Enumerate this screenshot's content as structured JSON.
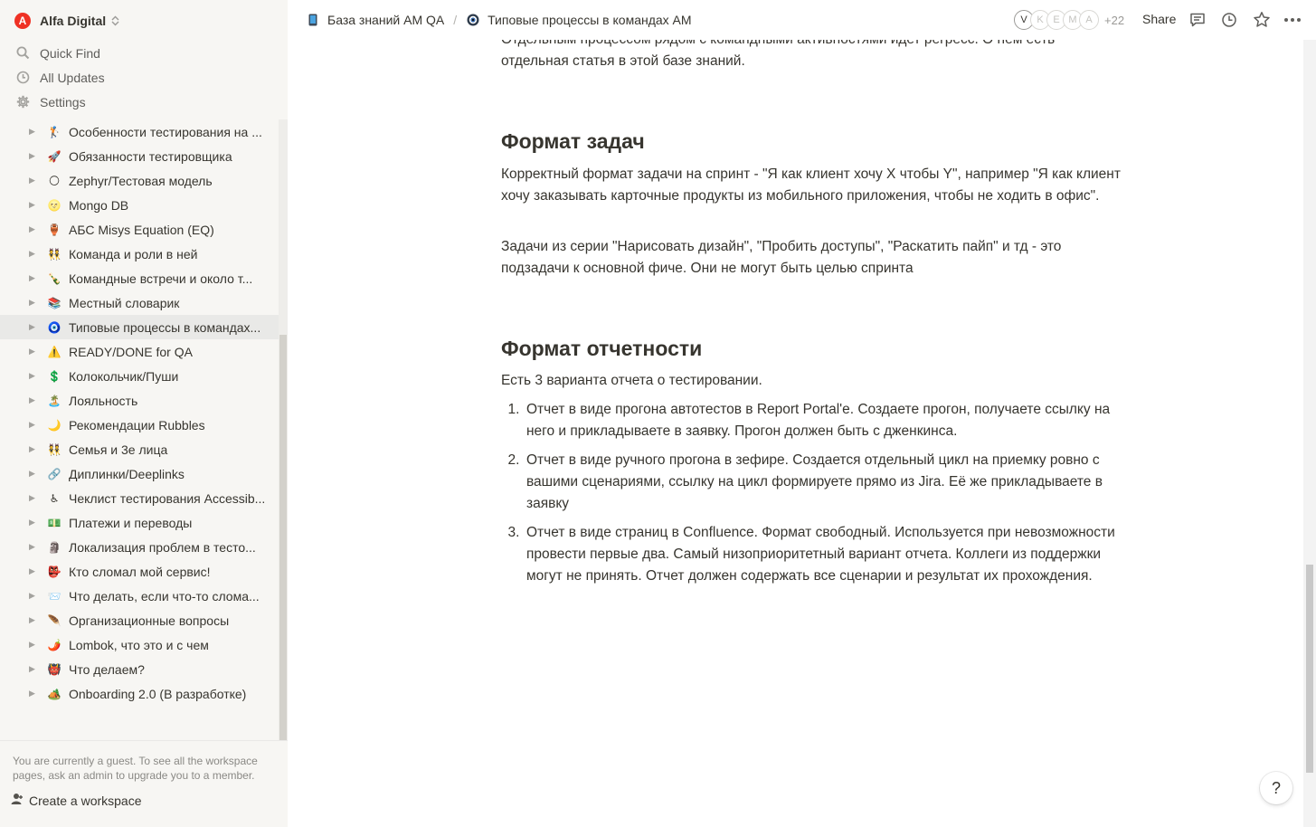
{
  "workspace": {
    "logo_letter": "A",
    "name": "Alfa Digital"
  },
  "nav": [
    {
      "label": "Quick Find",
      "icon": "search-icon"
    },
    {
      "label": "All Updates",
      "icon": "clock-icon"
    },
    {
      "label": "Settings",
      "icon": "gear-icon"
    }
  ],
  "tree": [
    {
      "emoji": "🏌️",
      "label": "Особенности тестирования на ...",
      "active": false
    },
    {
      "emoji": "🚀",
      "label": "Обязанности тестировщика",
      "active": false
    },
    {
      "emoji": "🌕",
      "label": "Zephyr/Тестовая модель",
      "active": false
    },
    {
      "emoji": "🌝",
      "label": "Mongo DB",
      "active": false
    },
    {
      "emoji": "🏺",
      "label": "АБС Misys Equation (EQ)",
      "active": false
    },
    {
      "emoji": "👯",
      "label": "Команда и роли в ней",
      "active": false
    },
    {
      "emoji": "🍾",
      "label": "Командные встречи и около т...",
      "active": false
    },
    {
      "emoji": "📚",
      "label": "Местный словарик",
      "active": false
    },
    {
      "emoji": "🧿",
      "label": "Типовые процессы в командах...",
      "active": true
    },
    {
      "emoji": "⚠️",
      "label": "READY/DONE for QA",
      "active": false
    },
    {
      "emoji": "💲",
      "label": "Колокольчик/Пуши",
      "active": false
    },
    {
      "emoji": "🏝️",
      "label": "Лояльность",
      "active": false
    },
    {
      "emoji": "🌙",
      "label": "Рекомендации Rubbles",
      "active": false
    },
    {
      "emoji": "👯",
      "label": "Семья и 3е лица",
      "active": false
    },
    {
      "emoji": "🔗",
      "label": "Диплинки/Deeplinks",
      "active": false
    },
    {
      "emoji": "♿",
      "label": "Чеклист тестирования Accessib...",
      "active": false
    },
    {
      "emoji": "💵",
      "label": "Платежи и переводы",
      "active": false
    },
    {
      "emoji": "🗿",
      "label": "Локализация проблем в тесто...",
      "active": false
    },
    {
      "emoji": "👺",
      "label": "Кто сломал мой сервис!",
      "active": false
    },
    {
      "emoji": "📨",
      "label": "Что делать, если что-то слома...",
      "active": false
    },
    {
      "emoji": "🪶",
      "label": "Организационные вопросы",
      "active": false
    },
    {
      "emoji": "🌶️",
      "label": "Lombok, что это и с чем",
      "active": false
    },
    {
      "emoji": "👹",
      "label": "Что делаем?",
      "active": false
    },
    {
      "emoji": "🏕️",
      "label": "Onboarding 2.0 (В разработке)",
      "active": false
    }
  ],
  "guest_note": "You are currently a guest. To see all the workspace pages, ask an admin to upgrade you to a member.",
  "create_workspace": "Create a workspace",
  "breadcrumb": [
    {
      "icon": "📱",
      "label": "База знаний АМ QA"
    },
    {
      "icon": "🧿",
      "label": "Типовые процессы в командах АМ"
    }
  ],
  "breadcrumb_separator": "/",
  "avatars": [
    "V",
    "K",
    "E",
    "M",
    "A"
  ],
  "avatars_more": "+22",
  "share_label": "Share",
  "content": {
    "intro_line1": "Отдельным процессом рядом с командными активностями идет регресс. О нем есть",
    "intro_line2": "отдельная статья в этой базе знаний.",
    "h_tasks": "Формат задач",
    "tasks_p1": "Корректный формат задачи на спринт - \"Я как клиент хочу X чтобы Y\", например \"Я как клиент хочу заказывать карточные продукты из мобильного приложения, чтобы не ходить в офис\".",
    "tasks_p2": "Задачи из серии \"Нарисовать дизайн\", \"Пробить доступы\", \"Раскатить пайп\" и тд - это подзадачи к основной фиче. Они не могут быть целью спринта",
    "h_report": "Формат отчетности",
    "report_intro": "Есть 3 варианта отчета о тестировании.",
    "report_items": [
      {
        "num": "1.",
        "text": "Отчет в виде прогона автотестов в Report Portal'е. Создаете прогон, получаете ссылку на него и прикладываете в заявку. Прогон должен быть с дженкинса."
      },
      {
        "num": "2.",
        "text": "Отчет в виде ручного прогона в зефире. Создается отдельный цикл на приемку ровно с вашими сценариями, ссылку на цикл формируете прямо из Jira. Её же прикладываете в заявку"
      },
      {
        "num": "3.",
        "text": "Отчет в виде страниц в Confluence. Формат свободный. Используется при невозможности провести первые два. Самый низоприоритетный вариант отчета. Коллеги из поддержки могут не принять. Отчет должен содержать все сценарии и результат их прохождения."
      }
    ]
  },
  "help_label": "?"
}
